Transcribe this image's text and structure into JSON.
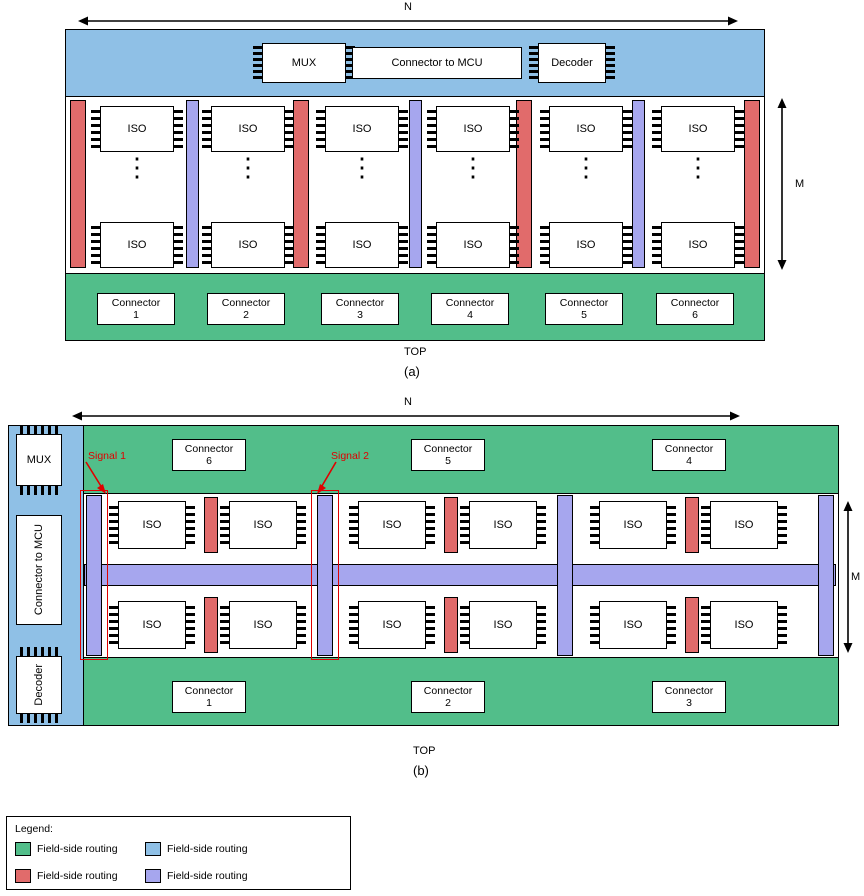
{
  "figure": {
    "panel_a": {
      "caption": "(a)",
      "top_label": "TOP",
      "dim_horizontal": "N",
      "dim_vertical": "M",
      "top_blocks": [
        {
          "label": "MUX"
        },
        {
          "label": "Connector to MCU"
        },
        {
          "label": "Decoder"
        }
      ],
      "iso_label": "ISO",
      "iso_columns": 6,
      "iso_rows_shown": 2,
      "vertical_dots": "⋮",
      "connectors": [
        {
          "line1": "Connector",
          "line2": "1"
        },
        {
          "line1": "Connector",
          "line2": "2"
        },
        {
          "line1": "Connector",
          "line2": "3"
        },
        {
          "line1": "Connector",
          "line2": "4"
        },
        {
          "line1": "Connector",
          "line2": "5"
        },
        {
          "line1": "Connector",
          "line2": "6"
        }
      ]
    },
    "panel_b": {
      "caption": "(b)",
      "top_label": "TOP",
      "dim_horizontal": "N",
      "dim_vertical": "M",
      "left_blocks": [
        {
          "label": "MUX"
        },
        {
          "label": "Connector to MCU"
        },
        {
          "label": "Decoder"
        }
      ],
      "iso_label": "ISO",
      "iso_columns": 6,
      "iso_rows": 2,
      "signals": [
        {
          "label": "Signal 1"
        },
        {
          "label": "Signal 2"
        }
      ],
      "connectors_top": [
        {
          "line1": "Connector",
          "line2": "6"
        },
        {
          "line1": "Connector",
          "line2": "5"
        },
        {
          "line1": "Connector",
          "line2": "4"
        }
      ],
      "connectors_bottom": [
        {
          "line1": "Connector",
          "line2": "1"
        },
        {
          "line1": "Connector",
          "line2": "2"
        },
        {
          "line1": "Connector",
          "line2": "3"
        }
      ]
    }
  },
  "legend": {
    "title": "Legend:",
    "items": [
      {
        "color": "#52be8a",
        "label": "Field-side routing"
      },
      {
        "color": "#8fc0e6",
        "label": "Field-side routing"
      },
      {
        "color": "#e16b6b",
        "label": "Field-side routing"
      },
      {
        "color": "#a6a6ee",
        "label": "Field-side routing"
      }
    ]
  },
  "colors": {
    "green": "#52be8a",
    "blue": "#8fc0e6",
    "red": "#e16b6b",
    "purple": "#a6a6ee",
    "signal_red": "#e00000"
  }
}
